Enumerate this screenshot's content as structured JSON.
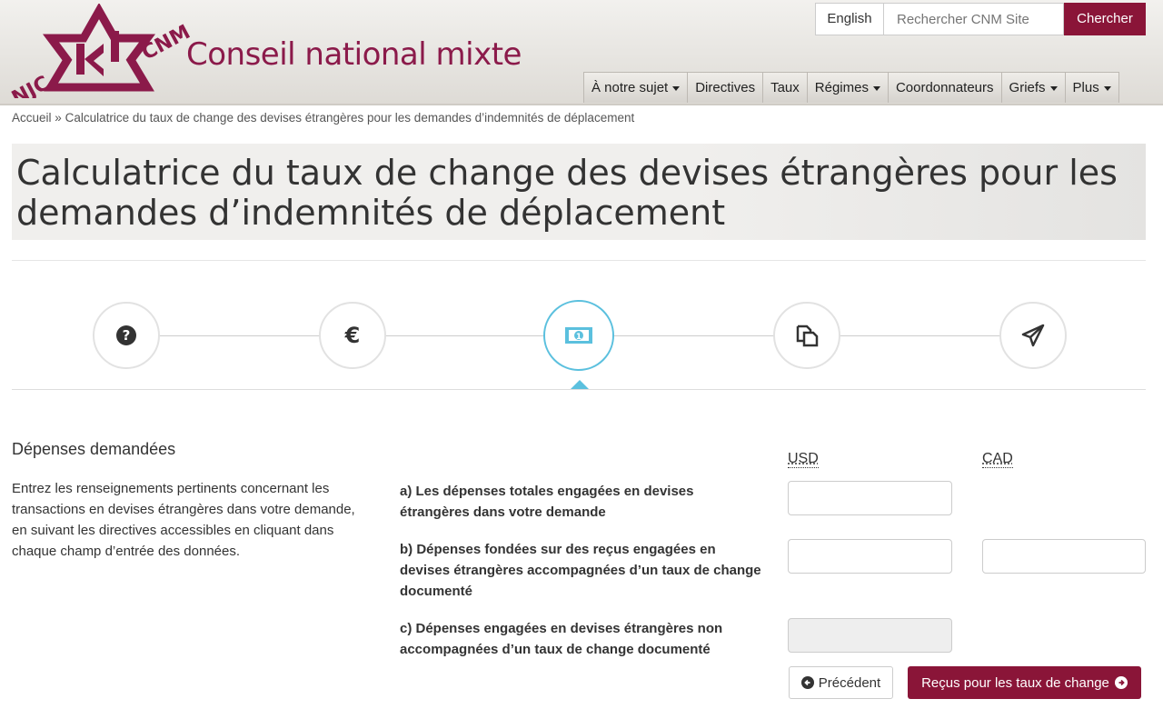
{
  "header": {
    "logo_left": "NJC",
    "logo_right": "CNM",
    "site_name": "Conseil national mixte",
    "language_toggle": "English",
    "search_placeholder": "Rechercher CNM Site",
    "search_button": "Chercher",
    "brand_color": "#8a1538"
  },
  "nav": {
    "items": [
      {
        "label": "À notre sujet",
        "dropdown": true
      },
      {
        "label": "Directives",
        "dropdown": false
      },
      {
        "label": "Taux",
        "dropdown": false
      },
      {
        "label": "Régimes",
        "dropdown": true
      },
      {
        "label": "Coordonnateurs",
        "dropdown": false
      },
      {
        "label": "Griefs",
        "dropdown": true
      },
      {
        "label": "Plus",
        "dropdown": true
      }
    ]
  },
  "breadcrumb": {
    "home": "Accueil",
    "separator": "»",
    "current": "Calculatrice du taux de change des devises étrangères pour les demandes d’indemnités de déplacement"
  },
  "page": {
    "title": "Calculatrice du taux de change des devises étrangères pour les demandes d’indemnités de déplacement"
  },
  "steps": [
    {
      "icon": "question-circle-icon",
      "glyph": "?"
    },
    {
      "icon": "euro-icon",
      "glyph": "€"
    },
    {
      "icon": "money-bill-icon",
      "glyph": "1",
      "active": true
    },
    {
      "icon": "copy-documents-icon"
    },
    {
      "icon": "paper-plane-icon"
    }
  ],
  "active_step_color": "#5bc0de",
  "form": {
    "section_title": "Dépenses demandées",
    "section_description": "Entrez les renseignements pertinents concernant les transactions en devises étrangères dans votre demande, en suivant les directives accessibles en cliquant dans chaque champ d’entrée des données.",
    "columns": {
      "usd": "USD",
      "cad": "CAD"
    },
    "rows": [
      {
        "label": "a) Les dépenses totales engagées en devises étrangères dans votre demande",
        "usd": "",
        "cad": null
      },
      {
        "label": "b) Dépenses fondées sur des reçus engagées en devises étrangères accompagnées d’un taux de change documenté",
        "usd": "",
        "cad": ""
      },
      {
        "label": "c) Dépenses engagées en devises étrangères non accompagnées d’un taux de change documenté",
        "usd": "",
        "cad": null,
        "usd_disabled": true
      }
    ],
    "prev_button": "Précédent",
    "next_button": "Reçus pour les taux de change"
  }
}
